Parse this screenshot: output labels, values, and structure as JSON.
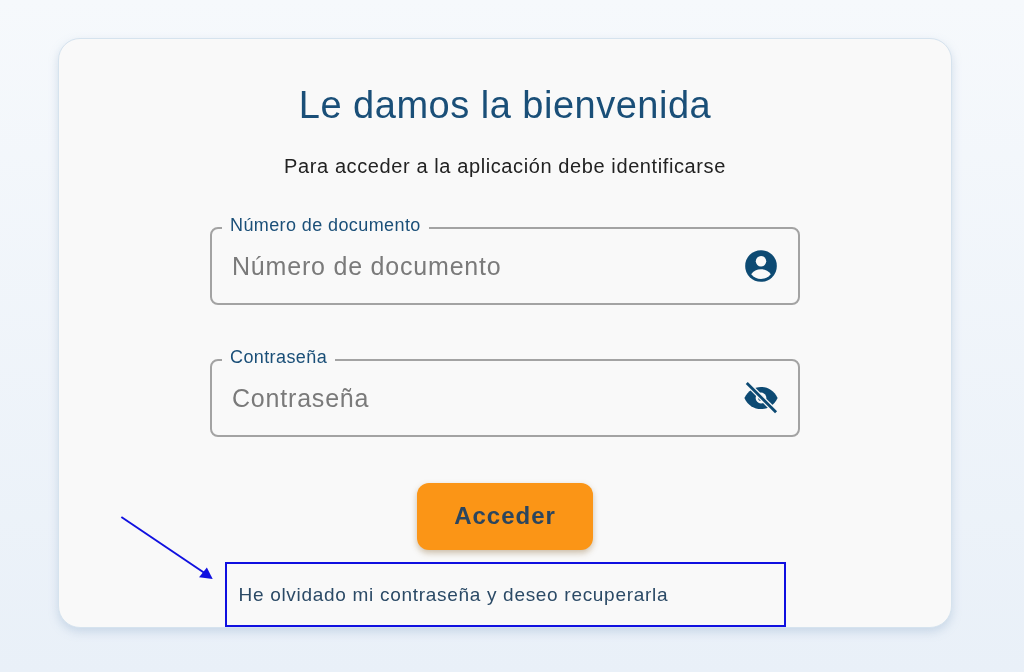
{
  "title": "Le damos la bienvenida",
  "subtitle": "Para acceder a la aplicación debe identificarse",
  "fields": [
    {
      "kind": "user",
      "label": "Número de documento",
      "placeholder": "Número de documento"
    },
    {
      "kind": "password",
      "label": "Contraseña",
      "placeholder": "Contraseña"
    }
  ],
  "button": {
    "label": "Acceder"
  },
  "link": {
    "text": "He olvidado mi contraseña y deseo recuperarla",
    "highlighted": true
  }
}
